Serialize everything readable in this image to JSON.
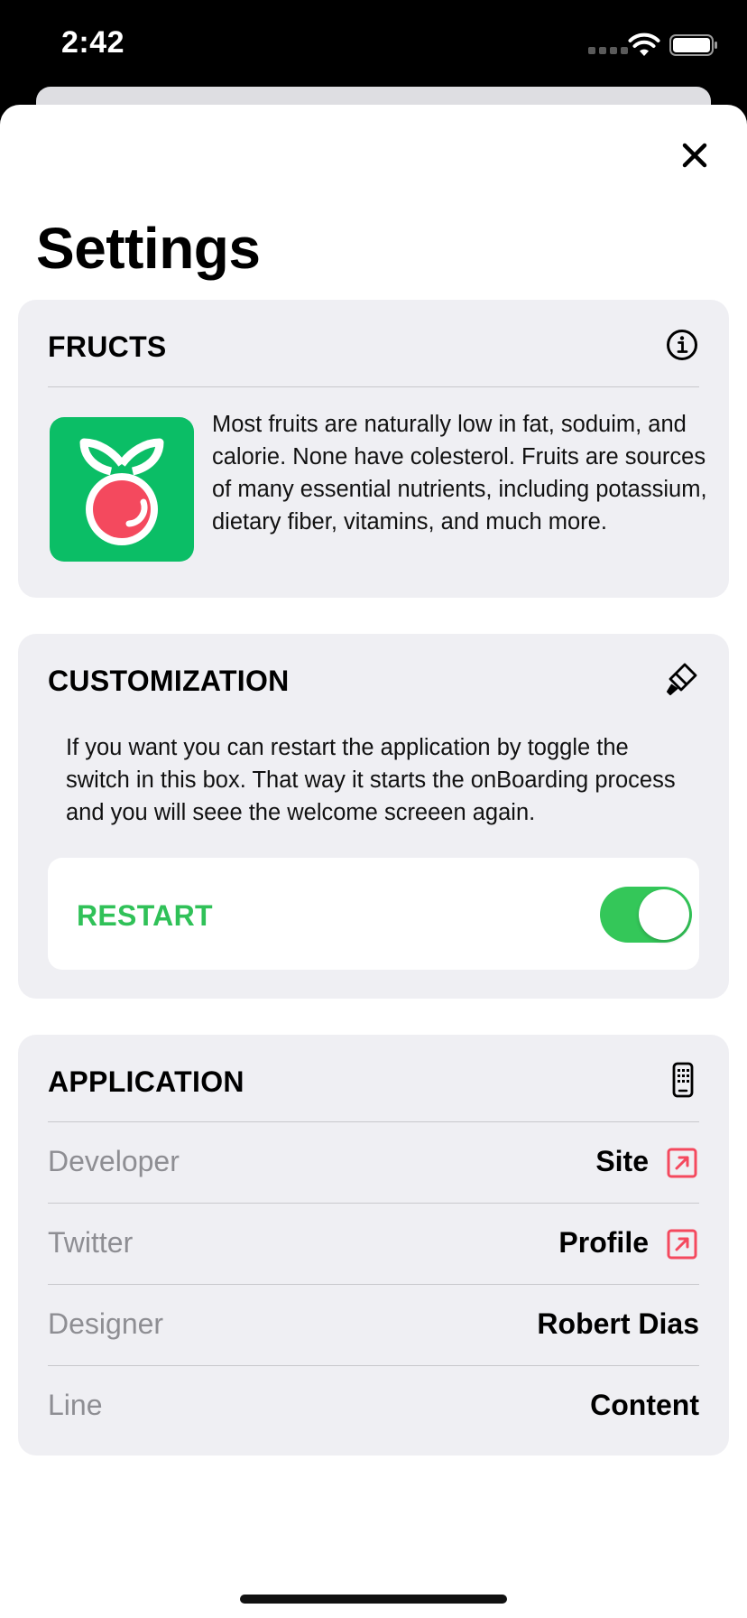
{
  "status_bar": {
    "time": "2:42"
  },
  "header": {
    "title": "Settings"
  },
  "fructs": {
    "title": "FRUCTS",
    "info_icon": "info-circle-icon",
    "description": "Most fruits are naturally low in fat, soduim, and calorie. None have colesterol. Fruits are sources of many essential nutrients, including potassium, dietary fiber, vitamins, and much more.",
    "logo_colors": {
      "background": "#0bbe66",
      "berry": "#f4495e"
    }
  },
  "customization": {
    "title": "CUSTOMIZATION",
    "icon": "paintbrush-icon",
    "description": "If you want you can restart the application by toggle the switch in this box. That way it starts the onBoarding process and you will seee the welcome screeen again.",
    "restart_label": "RESTART",
    "restart_on": true,
    "accent": "#30c158"
  },
  "application": {
    "title": "APPLICATION",
    "icon": "iphone-icon",
    "rows": [
      {
        "label": "Developer",
        "value": "Site",
        "link": true
      },
      {
        "label": "Twitter",
        "value": "Profile",
        "link": true
      },
      {
        "label": "Designer",
        "value": "Robert Dias",
        "link": false
      },
      {
        "label": "Line",
        "value": "Content",
        "link": false
      }
    ],
    "link_color": "#f4495e"
  }
}
